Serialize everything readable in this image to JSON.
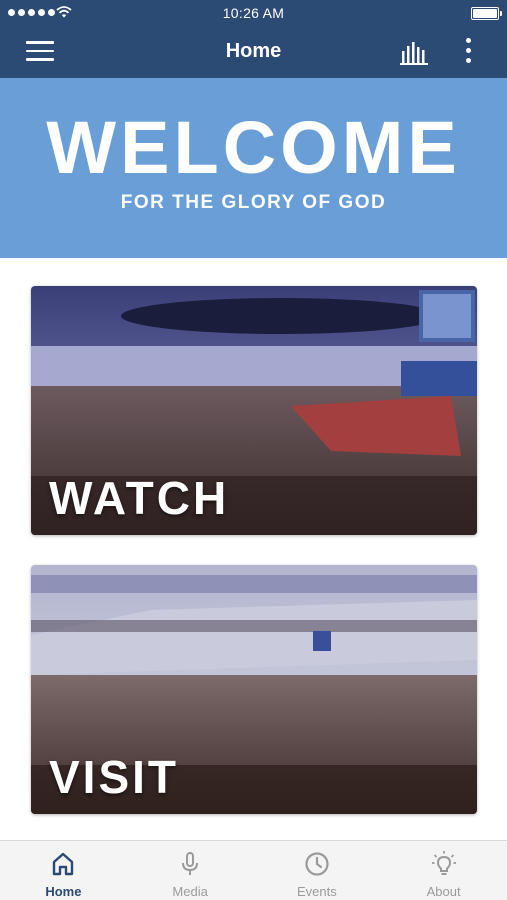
{
  "status_bar": {
    "time": "10:26 AM"
  },
  "app_bar": {
    "title": "Home"
  },
  "banner": {
    "title": "WELCOME",
    "subtitle": "FOR THE GLORY OF GOD"
  },
  "cards": [
    {
      "label": "WATCH"
    },
    {
      "label": "VISIT"
    }
  ],
  "tabs": [
    {
      "label": "Home",
      "icon": "home-icon",
      "active": true
    },
    {
      "label": "Media",
      "icon": "microphone-icon",
      "active": false
    },
    {
      "label": "Events",
      "icon": "clock-icon",
      "active": false
    },
    {
      "label": "About",
      "icon": "lightbulb-icon",
      "active": false
    }
  ],
  "colors": {
    "header": "#2b4a74",
    "banner": "#6a9ed6",
    "tab_active": "#2b4a74",
    "tab_inactive": "#9a9a9a"
  }
}
